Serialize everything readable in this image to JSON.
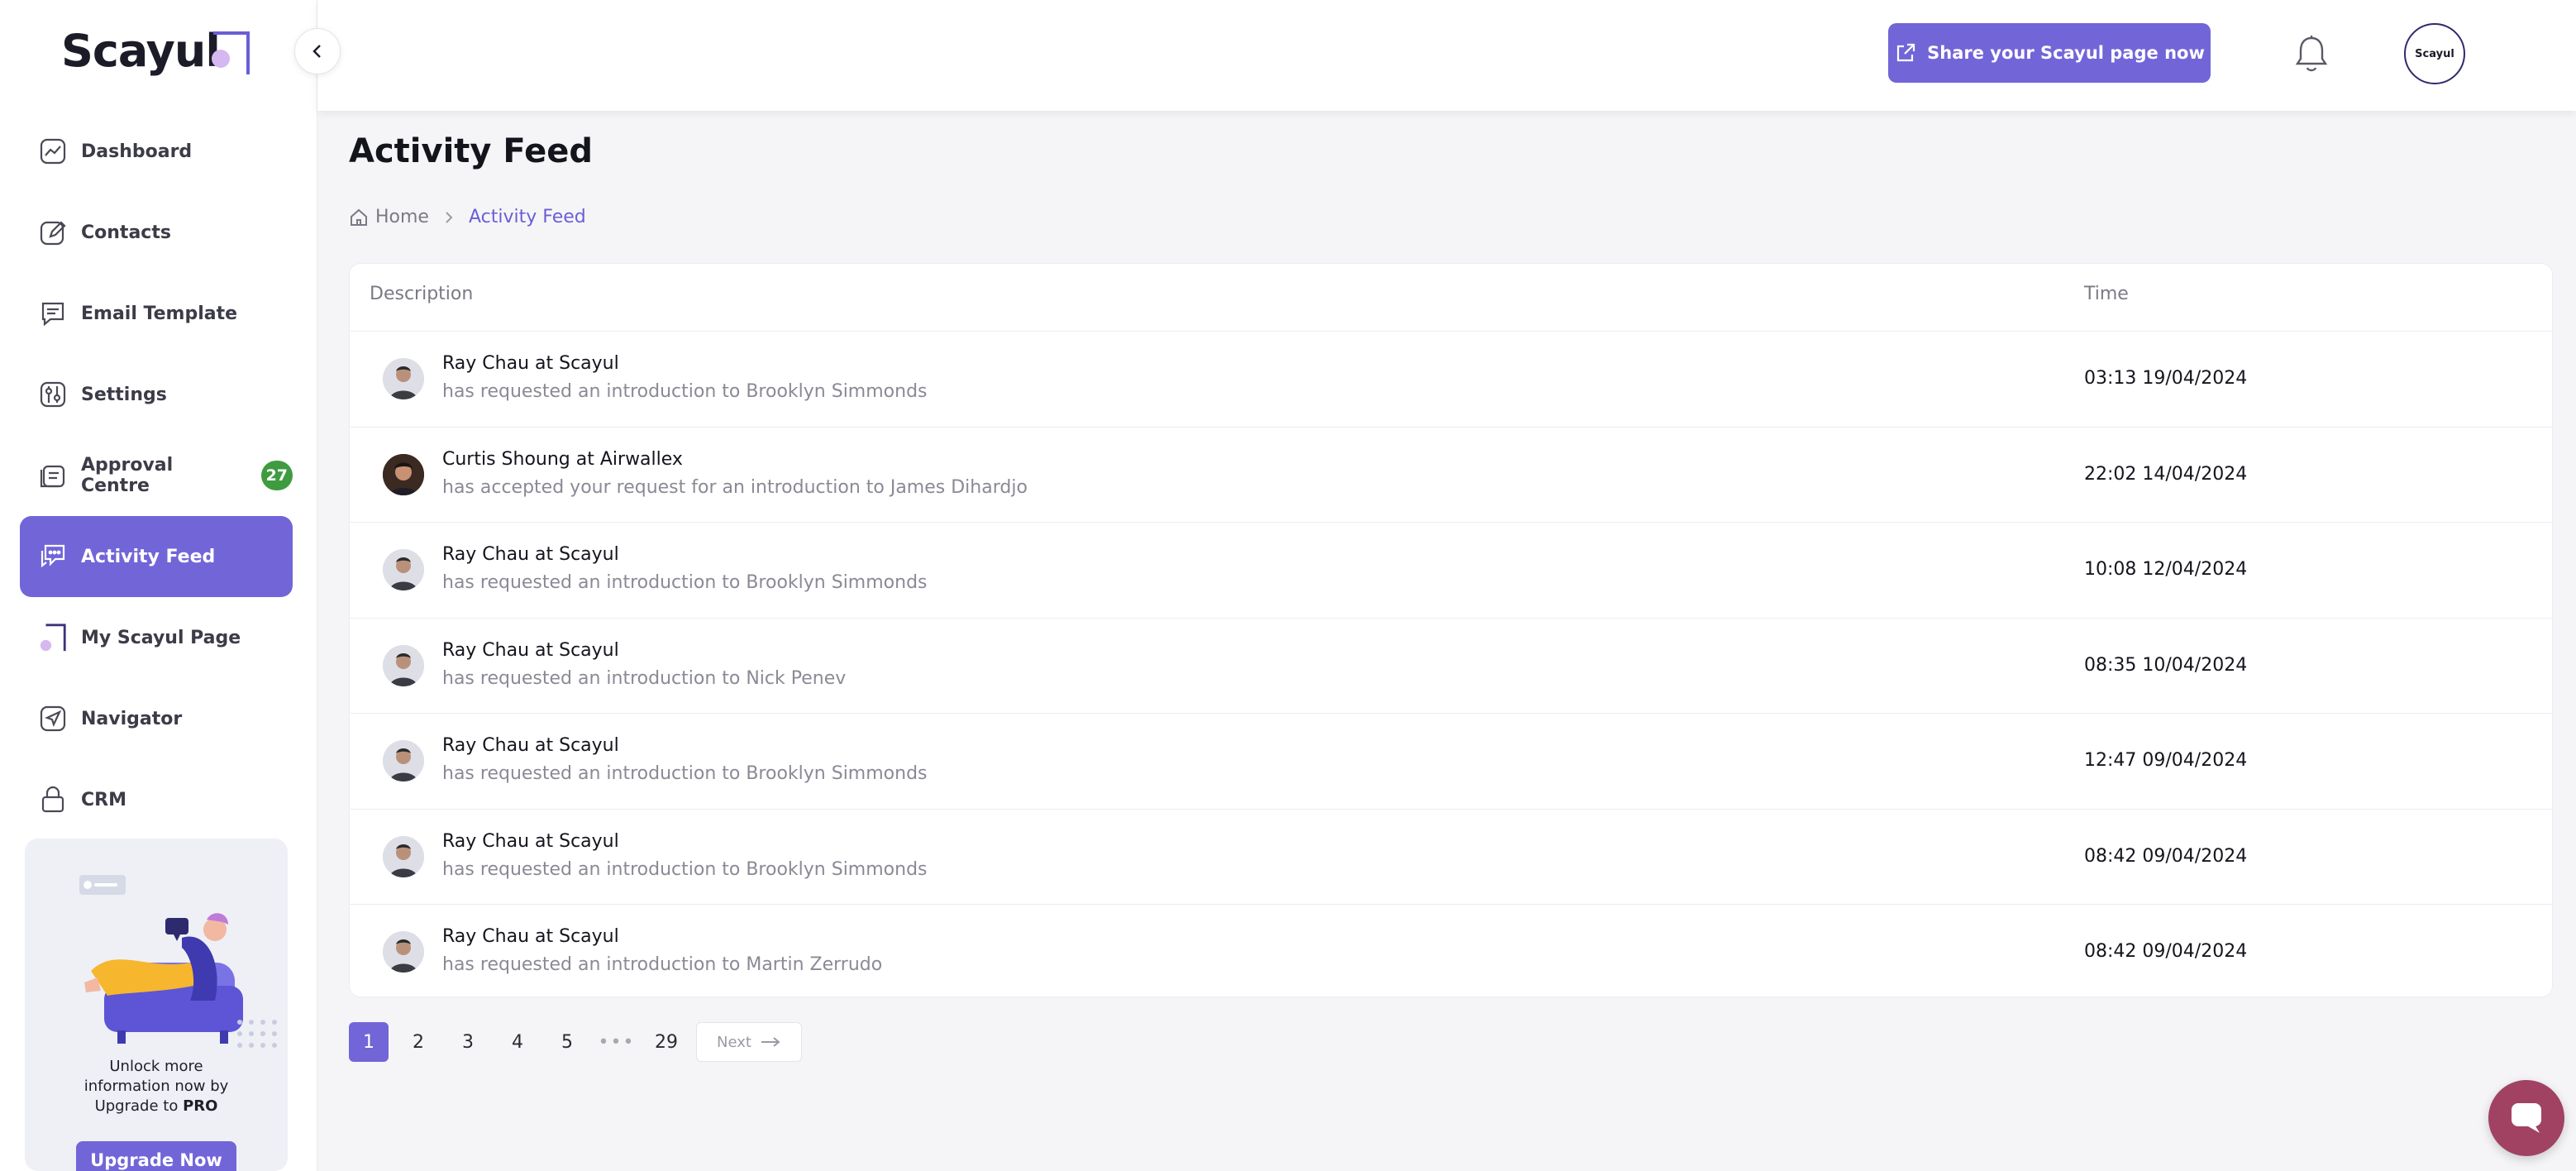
{
  "brand": {
    "name": "Scayul"
  },
  "sidebar": {
    "items": [
      {
        "label": "Dashboard",
        "icon": "dashboard-icon"
      },
      {
        "label": "Contacts",
        "icon": "contacts-icon"
      },
      {
        "label": "Email Template",
        "icon": "email-template-icon"
      },
      {
        "label": "Settings",
        "icon": "settings-icon"
      },
      {
        "label": "Approval Centre",
        "icon": "approval-icon",
        "badge": "27"
      },
      {
        "label": "Activity Feed",
        "icon": "activity-feed-icon",
        "active": true
      },
      {
        "label": "My Scayul Page",
        "icon": "scayul-page-icon"
      },
      {
        "label": "Navigator",
        "icon": "navigator-icon"
      },
      {
        "label": "CRM",
        "icon": "crm-icon"
      }
    ],
    "upgrade": {
      "text_line1": "Unlock more",
      "text_line2": "information now by",
      "text_line3_prefix": "Upgrade to ",
      "text_line3_strong": "PRO",
      "button": "Upgrade Now"
    }
  },
  "topbar": {
    "share_button": "Share your Scayul page now",
    "avatar_text": "Scayul"
  },
  "page": {
    "title": "Activity Feed",
    "breadcrumb": {
      "home": "Home",
      "current": "Activity Feed"
    }
  },
  "table": {
    "headers": {
      "description": "Description",
      "time": "Time"
    },
    "rows": [
      {
        "title": "Ray Chau at Scayul",
        "sub": "has requested an introduction to Brooklyn Simmonds",
        "time": "03:13 19/04/2024",
        "avatar": "light"
      },
      {
        "title": "Curtis Shoung at Airwallex",
        "sub": "has accepted your request for an introduction to James Dihardjo",
        "time": "22:02 14/04/2024",
        "avatar": "dark"
      },
      {
        "title": "Ray Chau at Scayul",
        "sub": "has requested an introduction to Brooklyn Simmonds",
        "time": "10:08 12/04/2024",
        "avatar": "light"
      },
      {
        "title": "Ray Chau at Scayul",
        "sub": "has requested an introduction to Nick Penev",
        "time": "08:35 10/04/2024",
        "avatar": "light"
      },
      {
        "title": "Ray Chau at Scayul",
        "sub": "has requested an introduction to Brooklyn Simmonds",
        "time": "12:47 09/04/2024",
        "avatar": "light"
      },
      {
        "title": "Ray Chau at Scayul",
        "sub": "has requested an introduction to Brooklyn Simmonds",
        "time": "08:42 09/04/2024",
        "avatar": "light"
      },
      {
        "title": "Ray Chau at Scayul",
        "sub": "has requested an introduction to Martin Zerrudo",
        "time": "08:42 09/04/2024",
        "avatar": "light"
      }
    ]
  },
  "pagination": {
    "pages": [
      "1",
      "2",
      "3",
      "4",
      "5"
    ],
    "dots": "•••",
    "last": "29",
    "current": "1",
    "next": "Next"
  },
  "colors": {
    "accent": "#7265d8",
    "badge": "#3f9b3f",
    "chat": "#a14262"
  }
}
